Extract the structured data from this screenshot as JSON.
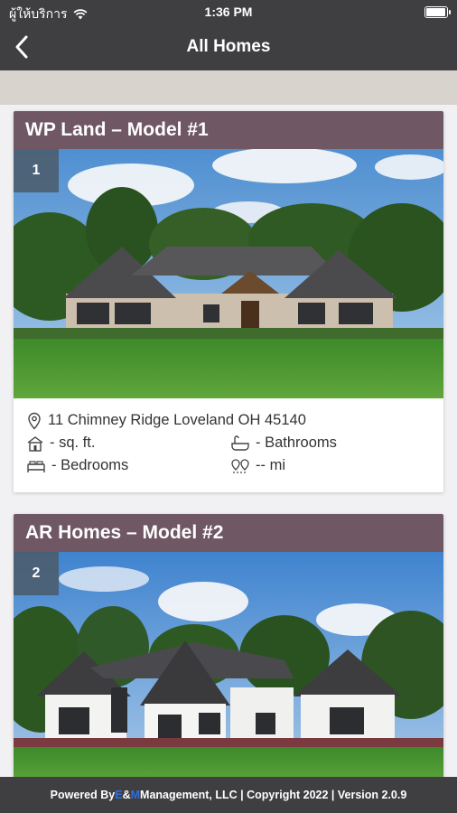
{
  "status_bar": {
    "carrier": "ผู้ให้บริการ",
    "time": "1:36 PM",
    "battery_level_pct": 95
  },
  "nav": {
    "title": "All Homes"
  },
  "cards": [
    {
      "title": "WP Land – Model #1",
      "number": "1",
      "address": "11 Chimney Ridge Loveland OH 45140",
      "sqft": "- sq. ft.",
      "bathrooms": "- Bathrooms",
      "bedrooms": "- Bedrooms",
      "distance": "-- mi"
    },
    {
      "title": "AR Homes – Model #2",
      "number": "2"
    }
  ],
  "footer": {
    "prefix": "Powered By ",
    "brand_e": "E",
    "brand_amp": "&",
    "brand_m": "M",
    "rest": " Management, LLC | Copyright 2022 | Version 2.0.9"
  },
  "colors": {
    "bar": "#3f3f42",
    "card_header": "#6f5763",
    "band": "#d9d3ce",
    "accent": "#2f6fd6"
  },
  "icons": [
    "wifi-icon",
    "battery-icon",
    "back-chevron-icon",
    "location-pin-icon",
    "house-icon",
    "bathtub-icon",
    "bed-icon",
    "distance-icon"
  ]
}
